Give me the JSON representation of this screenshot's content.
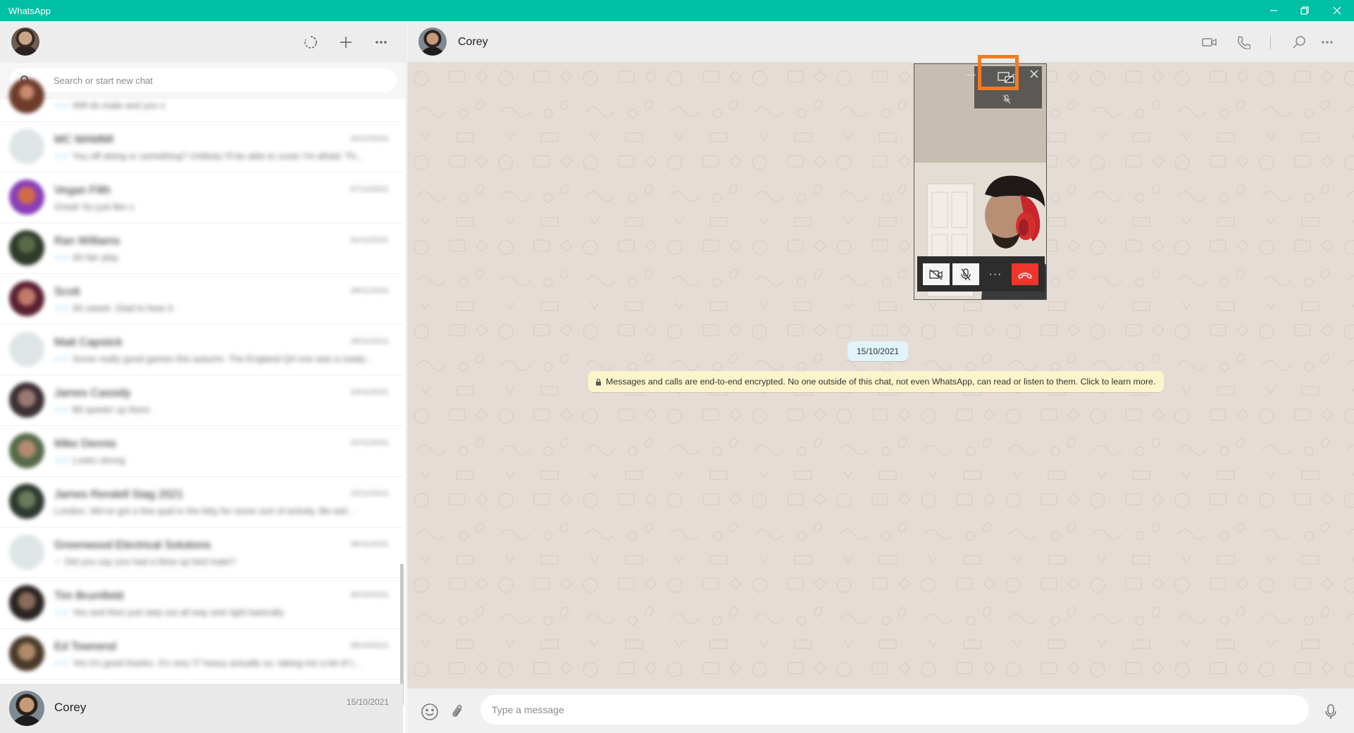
{
  "window": {
    "title": "WhatsApp",
    "accent_color": "#00bfa5"
  },
  "sidebar": {
    "header_icons": [
      "status-icon",
      "new-chat-icon",
      "menu-icon"
    ],
    "search": {
      "placeholder": "Search or start new chat"
    },
    "chats": [
      {
        "name": "",
        "preview": "Will do mate and you x",
        "time": ""
      },
      {
        "name": "MC MAMMI",
        "preview": "You off skiing or something? Unlikely I'll be able to cover I'm afraid. Th...",
        "time": "16/12/2021"
      },
      {
        "name": "Vegan Filth",
        "preview": "Great! So just like x",
        "time": "07/12/2021"
      },
      {
        "name": "Ran Williams",
        "preview": "Ah fair play",
        "time": "01/12/2021"
      },
      {
        "name": "Scott",
        "preview": "Ah sweet. Glad to hear it.",
        "time": "28/11/2021"
      },
      {
        "name": "Matt Capstick",
        "preview": "Some really good games this autumn. The England Q4 one was a ready...",
        "time": "26/11/2021"
      },
      {
        "name": "James Cassidy",
        "preview": "Bit quieter up there",
        "time": "24/11/2021"
      },
      {
        "name": "Mike Dennis",
        "preview": "Looks strong",
        "time": "22/11/2021"
      },
      {
        "name": "James Rendell Stag 2021",
        "preview": "London. We've got a few quid in the kitty for some sort of activity. Be wel...",
        "time": "22/11/2021"
      },
      {
        "name": "Greenwood Electrical Solutions",
        "preview": "Did you say you had a blow up bed mate?",
        "time": "06/11/2021"
      },
      {
        "name": "Tim Brumfield",
        "preview": "Yes and then just step out all way and right basically",
        "time": "30/10/2021"
      },
      {
        "name": "Ed Townend",
        "preview": "Yes it's good thanks. It's very IT heavy actually so, taking me a bit of t...",
        "time": "28/10/2021"
      }
    ],
    "active_chat": {
      "name": "Corey",
      "time": "15/10/2021"
    }
  },
  "conversation": {
    "contact_name": "Corey",
    "header_icons": [
      "video-call-icon",
      "voice-call-icon",
      "search-icon",
      "menu-icon"
    ],
    "date_label": "15/10/2021",
    "encryption_notice": "Messages and calls are end-to-end encrypted. No one outside of this chat, not even WhatsApp, can read or listen to them. Click to learn more.",
    "composer": {
      "placeholder": "Type a message"
    }
  },
  "video_call": {
    "minimize_label": "—",
    "more_label": "···",
    "end_call_color": "#f0352a",
    "highlight_color": "#f47a21",
    "controls": [
      "camera-off-icon",
      "mic-muted-icon",
      "more-icon",
      "end-call-icon"
    ]
  }
}
